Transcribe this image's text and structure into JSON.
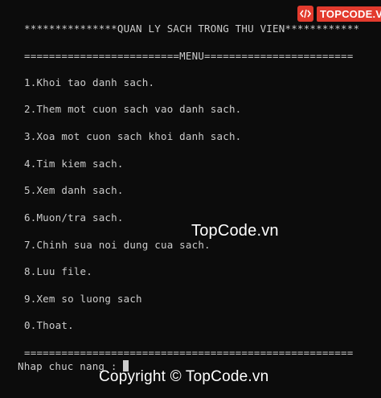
{
  "console": {
    "title_line": "***************QUAN LY SACH TRONG THU VIEN************",
    "menu_line": "=========================MENU========================",
    "items": [
      "1.Khoi tao danh sach.",
      "2.Them mot cuon sach vao danh sach.",
      "3.Xoa mot cuon sach khoi danh sach.",
      "4.Tim kiem sach.",
      "5.Xem danh sach.",
      "6.Muon/tra sach.",
      "7.Chinh sua noi dung cua sach.",
      "8.Luu file.",
      "9.Xem so luong sach",
      "0.Thoat."
    ],
    "footer_line": "=====================================================",
    "prompt": "Nhap chuc nang : "
  },
  "watermark": {
    "center": "TopCode.vn",
    "bottom": "Copyright © TopCode.vn",
    "logo_text": "TOPCODE.VN"
  },
  "colors": {
    "background": "#0c0c0c",
    "text": "#cccccc",
    "logo_accent": "#e33b2e"
  }
}
